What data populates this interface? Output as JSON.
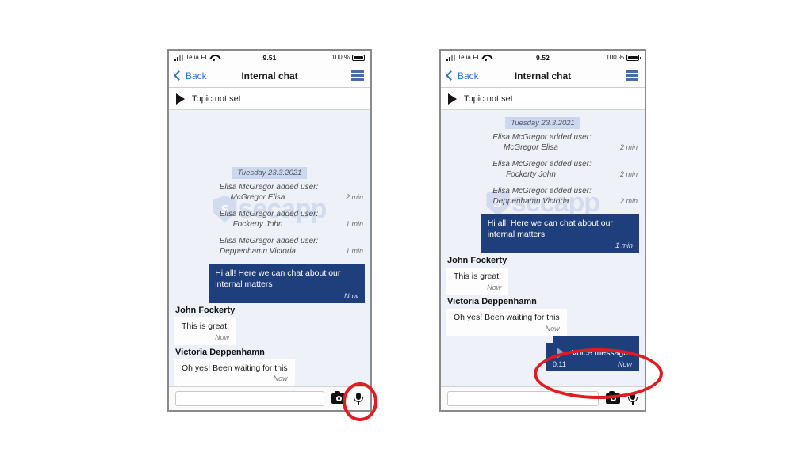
{
  "phones": [
    {
      "id": "left",
      "status_bar": {
        "carrier": "Telia FI",
        "time": "9.51",
        "battery": "100 %",
        "signal_icon": "signal-bars-icon",
        "wifi_icon": "wifi-icon",
        "battery_icon": "battery-full-icon"
      },
      "nav": {
        "back_label": "Back",
        "title": "Internal chat",
        "menu_icon": "hamburger-menu-icon",
        "back_icon": "chevron-left-icon"
      },
      "topic": {
        "label": "Topic not set",
        "icon": "play-triangle-icon"
      },
      "watermark": {
        "mark": "s",
        "text": "secapp"
      },
      "date_divider": "Tuesday 23.3.2021",
      "system_messages": [
        {
          "line1": "Elisa McGregor added user:",
          "line2": "McGregor Elisa",
          "age": "2 min"
        },
        {
          "line1": "Elisa McGregor added user:",
          "line2": "Fockerty John",
          "age": "1 min"
        },
        {
          "line1": "Elisa McGregor added user:",
          "line2": "Deppenhamn Victoria",
          "age": "1 min"
        }
      ],
      "messages": [
        {
          "kind": "outgoing",
          "text": "Hi all! Here we can chat about our internal matters",
          "time": "Now"
        },
        {
          "kind": "incoming",
          "sender": "John Fockerty",
          "text": "This is great!",
          "time": "Now"
        },
        {
          "kind": "incoming",
          "sender": "Victoria Deppenhamn",
          "text": "Oh yes! Been waiting for this",
          "time": "Now"
        }
      ],
      "input_bar": {
        "placeholder": "",
        "value": "",
        "camera_icon": "camera-icon",
        "mic_icon": "microphone-icon"
      },
      "annotation": "microphone-button-highlight"
    },
    {
      "id": "right",
      "status_bar": {
        "carrier": "Telia FI",
        "time": "9.52",
        "battery": "100 %",
        "signal_icon": "signal-bars-icon",
        "wifi_icon": "wifi-icon",
        "battery_icon": "battery-full-icon"
      },
      "nav": {
        "back_label": "Back",
        "title": "Internal chat",
        "menu_icon": "hamburger-menu-icon",
        "back_icon": "chevron-left-icon"
      },
      "topic": {
        "label": "Topic not set",
        "icon": "play-triangle-icon"
      },
      "watermark": {
        "mark": "s",
        "text": "secapp"
      },
      "date_divider": "Tuesday 23.3.2021",
      "system_messages": [
        {
          "line1": "Elisa McGregor added user:",
          "line2": "McGregor Elisa",
          "age": "2 min"
        },
        {
          "line1": "Elisa McGregor added user:",
          "line2": "Fockerty John",
          "age": "2 min"
        },
        {
          "line1": "Elisa McGregor added user:",
          "line2": "Deppenhamn Victoria",
          "age": "2 min"
        }
      ],
      "messages": [
        {
          "kind": "outgoing",
          "text": "Hi all! Here we can chat about our internal matters",
          "time": "1 min"
        },
        {
          "kind": "incoming",
          "sender": "John Fockerty",
          "text": "This is great!",
          "time": "Now"
        },
        {
          "kind": "incoming",
          "sender": "Victoria Deppenhamn",
          "text": "Oh yes! Been waiting for this",
          "time": "Now"
        }
      ],
      "voice_message": {
        "label": "Voice message",
        "duration": "0:11",
        "time": "Now",
        "play_icon": "play-triangle-icon"
      },
      "input_bar": {
        "placeholder": "",
        "value": "",
        "camera_icon": "camera-icon",
        "mic_icon": "microphone-icon"
      },
      "annotation": "voice-message-bubble-highlight"
    }
  ],
  "colors": {
    "outgoing_bubble": "#1f3e7c",
    "incoming_bubble": "#fdfdfd",
    "chat_background": "#eef1f7",
    "date_pill": "#ccd8ef",
    "link_blue": "#2f6fd0",
    "menu_blue": "#4a6ba8",
    "annotation_red": "#e01b22",
    "watermark_blue": "#b9c9e6"
  }
}
